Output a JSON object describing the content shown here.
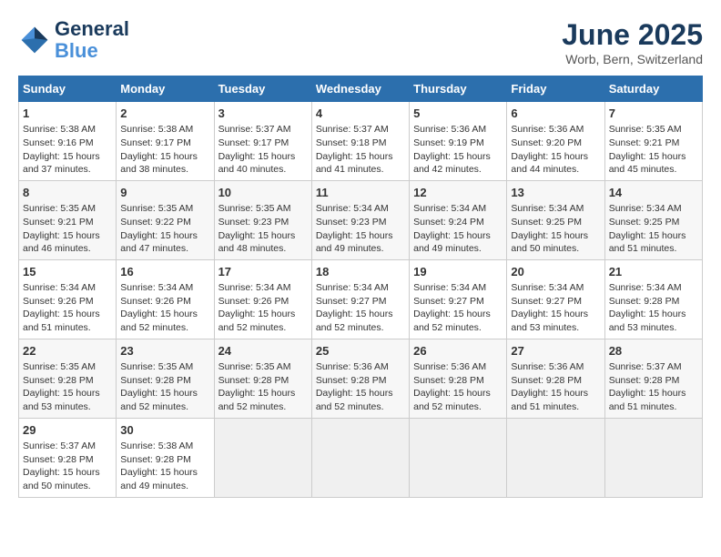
{
  "logo": {
    "line1": "General",
    "line2": "Blue"
  },
  "title": "June 2025",
  "location": "Worb, Bern, Switzerland",
  "headers": [
    "Sunday",
    "Monday",
    "Tuesday",
    "Wednesday",
    "Thursday",
    "Friday",
    "Saturday"
  ],
  "weeks": [
    [
      {
        "day": "1",
        "info": "Sunrise: 5:38 AM\nSunset: 9:16 PM\nDaylight: 15 hours\nand 37 minutes."
      },
      {
        "day": "2",
        "info": "Sunrise: 5:38 AM\nSunset: 9:17 PM\nDaylight: 15 hours\nand 38 minutes."
      },
      {
        "day": "3",
        "info": "Sunrise: 5:37 AM\nSunset: 9:17 PM\nDaylight: 15 hours\nand 40 minutes."
      },
      {
        "day": "4",
        "info": "Sunrise: 5:37 AM\nSunset: 9:18 PM\nDaylight: 15 hours\nand 41 minutes."
      },
      {
        "day": "5",
        "info": "Sunrise: 5:36 AM\nSunset: 9:19 PM\nDaylight: 15 hours\nand 42 minutes."
      },
      {
        "day": "6",
        "info": "Sunrise: 5:36 AM\nSunset: 9:20 PM\nDaylight: 15 hours\nand 44 minutes."
      },
      {
        "day": "7",
        "info": "Sunrise: 5:35 AM\nSunset: 9:21 PM\nDaylight: 15 hours\nand 45 minutes."
      }
    ],
    [
      {
        "day": "8",
        "info": "Sunrise: 5:35 AM\nSunset: 9:21 PM\nDaylight: 15 hours\nand 46 minutes."
      },
      {
        "day": "9",
        "info": "Sunrise: 5:35 AM\nSunset: 9:22 PM\nDaylight: 15 hours\nand 47 minutes."
      },
      {
        "day": "10",
        "info": "Sunrise: 5:35 AM\nSunset: 9:23 PM\nDaylight: 15 hours\nand 48 minutes."
      },
      {
        "day": "11",
        "info": "Sunrise: 5:34 AM\nSunset: 9:23 PM\nDaylight: 15 hours\nand 49 minutes."
      },
      {
        "day": "12",
        "info": "Sunrise: 5:34 AM\nSunset: 9:24 PM\nDaylight: 15 hours\nand 49 minutes."
      },
      {
        "day": "13",
        "info": "Sunrise: 5:34 AM\nSunset: 9:25 PM\nDaylight: 15 hours\nand 50 minutes."
      },
      {
        "day": "14",
        "info": "Sunrise: 5:34 AM\nSunset: 9:25 PM\nDaylight: 15 hours\nand 51 minutes."
      }
    ],
    [
      {
        "day": "15",
        "info": "Sunrise: 5:34 AM\nSunset: 9:26 PM\nDaylight: 15 hours\nand 51 minutes."
      },
      {
        "day": "16",
        "info": "Sunrise: 5:34 AM\nSunset: 9:26 PM\nDaylight: 15 hours\nand 52 minutes."
      },
      {
        "day": "17",
        "info": "Sunrise: 5:34 AM\nSunset: 9:26 PM\nDaylight: 15 hours\nand 52 minutes."
      },
      {
        "day": "18",
        "info": "Sunrise: 5:34 AM\nSunset: 9:27 PM\nDaylight: 15 hours\nand 52 minutes."
      },
      {
        "day": "19",
        "info": "Sunrise: 5:34 AM\nSunset: 9:27 PM\nDaylight: 15 hours\nand 52 minutes."
      },
      {
        "day": "20",
        "info": "Sunrise: 5:34 AM\nSunset: 9:27 PM\nDaylight: 15 hours\nand 53 minutes."
      },
      {
        "day": "21",
        "info": "Sunrise: 5:34 AM\nSunset: 9:28 PM\nDaylight: 15 hours\nand 53 minutes."
      }
    ],
    [
      {
        "day": "22",
        "info": "Sunrise: 5:35 AM\nSunset: 9:28 PM\nDaylight: 15 hours\nand 53 minutes."
      },
      {
        "day": "23",
        "info": "Sunrise: 5:35 AM\nSunset: 9:28 PM\nDaylight: 15 hours\nand 52 minutes."
      },
      {
        "day": "24",
        "info": "Sunrise: 5:35 AM\nSunset: 9:28 PM\nDaylight: 15 hours\nand 52 minutes."
      },
      {
        "day": "25",
        "info": "Sunrise: 5:36 AM\nSunset: 9:28 PM\nDaylight: 15 hours\nand 52 minutes."
      },
      {
        "day": "26",
        "info": "Sunrise: 5:36 AM\nSunset: 9:28 PM\nDaylight: 15 hours\nand 52 minutes."
      },
      {
        "day": "27",
        "info": "Sunrise: 5:36 AM\nSunset: 9:28 PM\nDaylight: 15 hours\nand 51 minutes."
      },
      {
        "day": "28",
        "info": "Sunrise: 5:37 AM\nSunset: 9:28 PM\nDaylight: 15 hours\nand 51 minutes."
      }
    ],
    [
      {
        "day": "29",
        "info": "Sunrise: 5:37 AM\nSunset: 9:28 PM\nDaylight: 15 hours\nand 50 minutes."
      },
      {
        "day": "30",
        "info": "Sunrise: 5:38 AM\nSunset: 9:28 PM\nDaylight: 15 hours\nand 49 minutes."
      },
      {
        "day": "",
        "info": ""
      },
      {
        "day": "",
        "info": ""
      },
      {
        "day": "",
        "info": ""
      },
      {
        "day": "",
        "info": ""
      },
      {
        "day": "",
        "info": ""
      }
    ]
  ]
}
